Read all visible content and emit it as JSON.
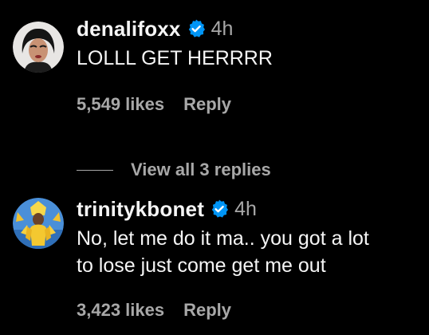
{
  "colors": {
    "background": "#000000",
    "primary_text": "#f5f5f5",
    "secondary_text": "#a8a8a8",
    "verified_badge": "#0095f6"
  },
  "comments": [
    {
      "username": "denalifoxx",
      "verified": true,
      "time": "4h",
      "text": "LOLLL GET HERRRR",
      "likes": "5,549 likes",
      "reply_label": "Reply",
      "avatar_icon": "avatar-denalifoxx"
    },
    {
      "username": "trinitykbonet",
      "verified": true,
      "time": "4h",
      "text": "No, let me do it ma.. you got a lot\nto lose just come get me out",
      "likes": "3,423 likes",
      "reply_label": "Reply",
      "avatar_icon": "avatar-trinitykbonet"
    }
  ],
  "view_replies": {
    "label": "View all 3 replies"
  }
}
